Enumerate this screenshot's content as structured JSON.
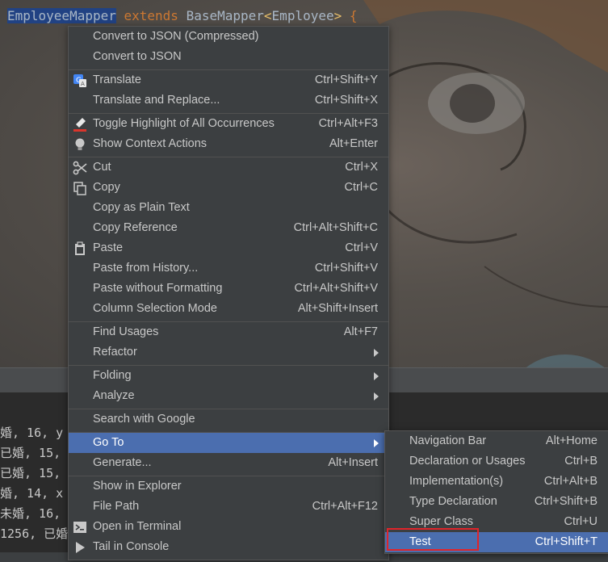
{
  "editor": {
    "class_name": "EmployeeMapper",
    "extends_kw": "extends",
    "base": "BaseMapper",
    "lt": "<",
    "generic_type": "Employee",
    "gt": ">",
    "brace": " {"
  },
  "console": {
    "lines": [
      "婚, 16, y",
      "已婚, 15,",
      "已婚, 15,",
      "婚, 14, x",
      "未婚, 16,",
      "1256, 已婚"
    ]
  },
  "main_menu": {
    "items": [
      {
        "label": "Convert to JSON (Compressed)",
        "shortcut": ""
      },
      {
        "label": "Convert to JSON",
        "shortcut": ""
      },
      {
        "label": "Translate",
        "shortcut": "Ctrl+Shift+Y",
        "icon": "google-translate-icon"
      },
      {
        "label": "Translate and Replace...",
        "shortcut": "Ctrl+Shift+X"
      },
      {
        "label": "Toggle Highlight of All Occurrences",
        "shortcut": "Ctrl+Alt+F3",
        "icon": "highlighter-icon"
      },
      {
        "label": "Show Context Actions",
        "shortcut": "Alt+Enter",
        "icon": "lightbulb-icon"
      },
      {
        "label": "Cut",
        "shortcut": "Ctrl+X",
        "icon": "scissors-icon"
      },
      {
        "label": "Copy",
        "shortcut": "Ctrl+C",
        "icon": "copy-icon"
      },
      {
        "label": "Copy as Plain Text",
        "shortcut": ""
      },
      {
        "label": "Copy Reference",
        "shortcut": "Ctrl+Alt+Shift+C"
      },
      {
        "label": "Paste",
        "shortcut": "Ctrl+V",
        "icon": "clipboard-icon"
      },
      {
        "label": "Paste from History...",
        "shortcut": "Ctrl+Shift+V"
      },
      {
        "label": "Paste without Formatting",
        "shortcut": "Ctrl+Alt+Shift+V"
      },
      {
        "label": "Column Selection Mode",
        "shortcut": "Alt+Shift+Insert"
      },
      {
        "label": "Find Usages",
        "shortcut": "Alt+F7"
      },
      {
        "label": "Refactor",
        "shortcut": ""
      },
      {
        "label": "Folding",
        "shortcut": ""
      },
      {
        "label": "Analyze",
        "shortcut": ""
      },
      {
        "label": "Search with Google",
        "shortcut": ""
      },
      {
        "label": "Go To",
        "shortcut": ""
      },
      {
        "label": "Generate...",
        "shortcut": "Alt+Insert"
      },
      {
        "label": "Show in Explorer",
        "shortcut": ""
      },
      {
        "label": "File Path",
        "shortcut": "Ctrl+Alt+F12"
      },
      {
        "label": "Open in Terminal",
        "shortcut": "",
        "icon": "terminal-icon"
      },
      {
        "label": "Tail in Console",
        "shortcut": "",
        "icon": "play-icon"
      }
    ]
  },
  "sub_menu": {
    "items": [
      {
        "label": "Navigation Bar",
        "shortcut": "Alt+Home"
      },
      {
        "label": "Declaration or Usages",
        "shortcut": "Ctrl+B"
      },
      {
        "label": "Implementation(s)",
        "shortcut": "Ctrl+Alt+B"
      },
      {
        "label": "Type Declaration",
        "shortcut": "Ctrl+Shift+B"
      },
      {
        "label": "Super Class",
        "shortcut": "Ctrl+U"
      },
      {
        "label": "Test",
        "shortcut": "Ctrl+Shift+T"
      }
    ]
  },
  "colors": {
    "menu_bg": "#3c3f41",
    "selection": "#4b6eaf",
    "highlight_box": "#e0242a",
    "keyword": "#cc7832",
    "generic": "#e8bf6a"
  }
}
